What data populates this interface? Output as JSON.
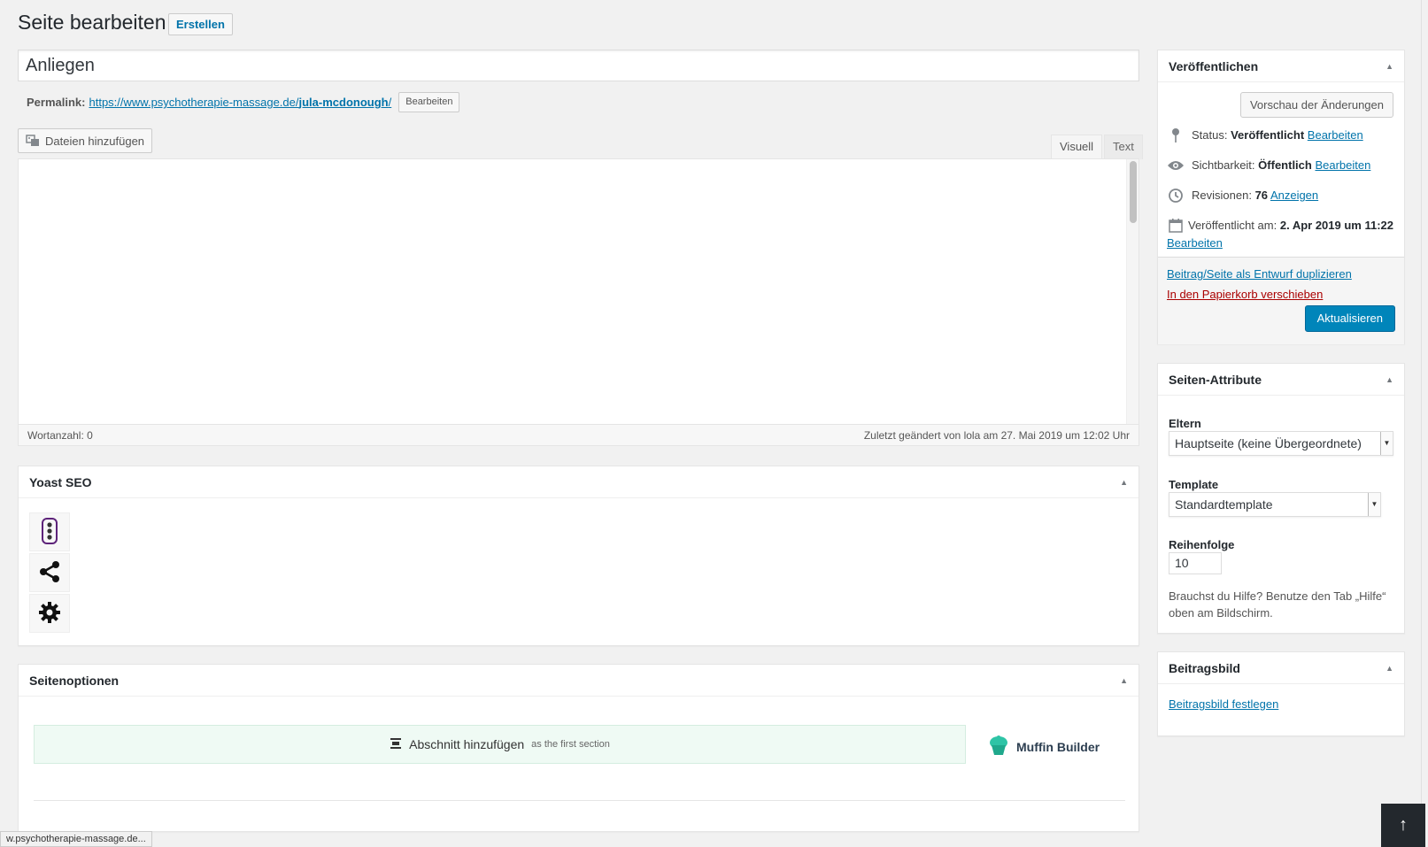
{
  "page": {
    "title": "Seite bearbeiten",
    "create_label": "Erstellen"
  },
  "post": {
    "title": "Anliegen",
    "permalink_label": "Permalink:",
    "permalink_url_base": "https://www.psychotherapie-massage.de/",
    "permalink_slug": "jula-mcdonough",
    "permalink_trailing": "/",
    "permalink_edit": "Bearbeiten"
  },
  "editor": {
    "add_media": "Dateien hinzufügen",
    "tab_visual": "Visuell",
    "tab_text": "Text",
    "word_count": "Wortanzahl: 0",
    "last_edited": "Zuletzt geändert von lola am 27. Mai 2019 um 12:02 Uhr"
  },
  "yoast": {
    "title": "Yoast SEO"
  },
  "options": {
    "title": "Seitenoptionen",
    "add_section": "Abschnitt hinzufügen",
    "add_section_suffix": "as the first section",
    "builder_name": "Muffin Builder"
  },
  "publish": {
    "title": "Veröffentlichen",
    "preview": "Vorschau der Änderungen",
    "status_label": "Status:",
    "status_value": "Veröffentlicht",
    "visibility_label": "Sichtbarkeit:",
    "visibility_value": "Öffentlich",
    "revisions_label": "Revisionen:",
    "revisions_value": "76",
    "revisions_link": "Anzeigen",
    "published_label": "Veröffentlicht am:",
    "published_value_1": "2. Apr 2019 um",
    "published_value_2": "11:22",
    "edit_link": "Bearbeiten",
    "duplicate": "Beitrag/Seite als Entwurf duplizieren",
    "trash": "In den Papierkorb verschieben",
    "update": "Aktualisieren"
  },
  "attributes": {
    "title": "Seiten-Attribute",
    "parent_label": "Eltern",
    "parent_value": "Hauptseite (keine Übergeordnete)",
    "template_label": "Template",
    "template_value": "Standardtemplate",
    "order_label": "Reihenfolge",
    "order_value": "10",
    "help": "Brauchst du Hilfe? Benutze den Tab „Hilfe“ oben am Bildschirm."
  },
  "featured": {
    "title": "Beitragsbild",
    "set_link": "Beitragsbild festlegen"
  },
  "statusbar": {
    "url": "w.psychotherapie-massage.de..."
  },
  "colors": {
    "primary": "#0085ba",
    "link": "#0073aa",
    "danger": "#a00000",
    "muffin_accent": "#2ec4a6"
  }
}
